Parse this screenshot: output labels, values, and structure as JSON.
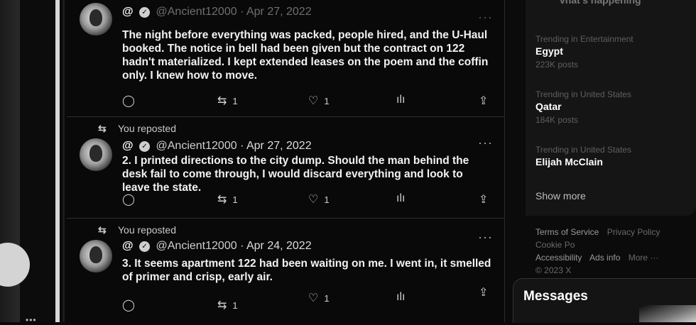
{
  "timeline": {
    "tweets": [
      {
        "reposted": false,
        "at": "@",
        "handle": "@Ancient12000",
        "date": "· Apr 27, 2022",
        "text": "The night before everything was packed, people hired, and the U-Haul booked. The notice in bell had been given but the contract on 122 hadn't materialized. I kept extended leases on the poem and the coffin only. I knew how to move.",
        "reply_count": "",
        "repost_count": "1",
        "like_count": "1"
      },
      {
        "reposted": true,
        "repost_label": "You reposted",
        "at": "@",
        "handle": "@Ancient12000",
        "date": "· Apr 27, 2022",
        "text": "2. I printed directions to the city dump. Should the man behind the desk fail to come through, I would discard everything and look to leave the state.",
        "reply_count": "",
        "repost_count": "1",
        "like_count": "1"
      },
      {
        "reposted": true,
        "repost_label": "You reposted",
        "at": "@",
        "handle": "@Ancient12000",
        "date": "· Apr 24, 2022",
        "text": "3. It seems apartment 122 had been waiting on me. I went in, it smelled of primer and crisp, early air.",
        "reply_count": "",
        "repost_count": "1",
        "like_count": "1"
      }
    ],
    "icons": {
      "reply": "reply-icon",
      "repost": "repost-icon",
      "like": "heart-icon",
      "views": "views-icon",
      "share": "share-icon",
      "more": "more-icon",
      "verified": "verified-icon"
    }
  },
  "sidebar": {
    "header_fragment": "vhat's happening",
    "trends": [
      {
        "context": "Trending in Entertainment",
        "name": "Egypt",
        "count": "223K posts"
      },
      {
        "context": "Trending in United States",
        "name": "Qatar",
        "count": "184K posts"
      },
      {
        "context": "Trending in United States",
        "name": "Elijah McClain",
        "count": ""
      }
    ],
    "show_more": "Show more",
    "footer": {
      "terms": "Terms of Service",
      "privacy": "Privacy Policy",
      "cookie": "Cookie Po",
      "accessibility": "Accessibility",
      "ads": "Ads info",
      "more": "More ···",
      "copyright": "© 2023 X"
    },
    "messages_title": "Messages"
  }
}
